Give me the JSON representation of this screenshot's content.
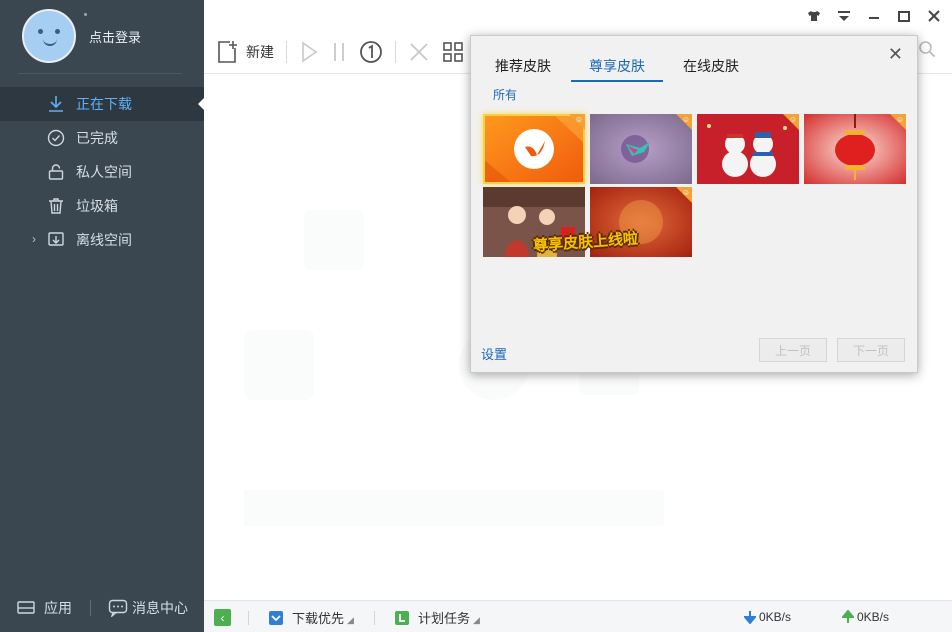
{
  "sidebar": {
    "login_label": "点击登录",
    "nav": [
      {
        "label": "正在下载",
        "icon": "download-arrow-icon",
        "active": true
      },
      {
        "label": "已完成",
        "icon": "check-circle-icon",
        "active": false
      },
      {
        "label": "私人空间",
        "icon": "lock-icon",
        "active": false
      },
      {
        "label": "垃圾箱",
        "icon": "trash-icon",
        "active": false
      },
      {
        "label": "离线空间",
        "icon": "cloud-download-icon",
        "active": false,
        "expandable": true
      }
    ],
    "bottom": {
      "apps_label": "应用",
      "messages_label": "消息中心"
    },
    "colors": {
      "background": "#3a4650",
      "active_background": "#2d3841",
      "active_text": "#5fb0f5"
    }
  },
  "toolbar": {
    "new_label": "新建",
    "icons": [
      "add-file-icon",
      "play-icon",
      "pause-icon",
      "speed-limit-icon",
      "delete-icon",
      "grid-view-icon",
      "search-icon"
    ]
  },
  "window_controls": [
    "skin-shirt-icon",
    "menu-dropdown-icon",
    "minimize-icon",
    "maximize-icon",
    "close-icon"
  ],
  "skin_dialog": {
    "tabs": [
      {
        "label": "推荐皮肤",
        "active": false
      },
      {
        "label": "尊享皮肤",
        "active": true
      },
      {
        "label": "在线皮肤",
        "active": false
      }
    ],
    "filter_label": "所有",
    "thumbnails": [
      {
        "name": "orange-bird",
        "selected": true
      },
      {
        "name": "purple-hummingbird",
        "selected": false
      },
      {
        "name": "snowmen",
        "selected": false
      },
      {
        "name": "red-lantern",
        "selected": false
      },
      {
        "name": "new-year-couple",
        "selected": false
      },
      {
        "name": "premium-launch",
        "selected": false
      }
    ],
    "banner_text": "尊享皮肤上线啦",
    "settings_label": "设置",
    "prev_label": "上一页",
    "next_label": "下一页",
    "accent_color": "#1b68b8"
  },
  "statusbar": {
    "priority_label": "下载优先",
    "schedule_label": "计划任务",
    "download_speed": "0KB/s",
    "upload_speed": "0KB/s",
    "colors": {
      "download_arrow": "#2f7fd6",
      "upload_arrow": "#4caf50"
    }
  }
}
